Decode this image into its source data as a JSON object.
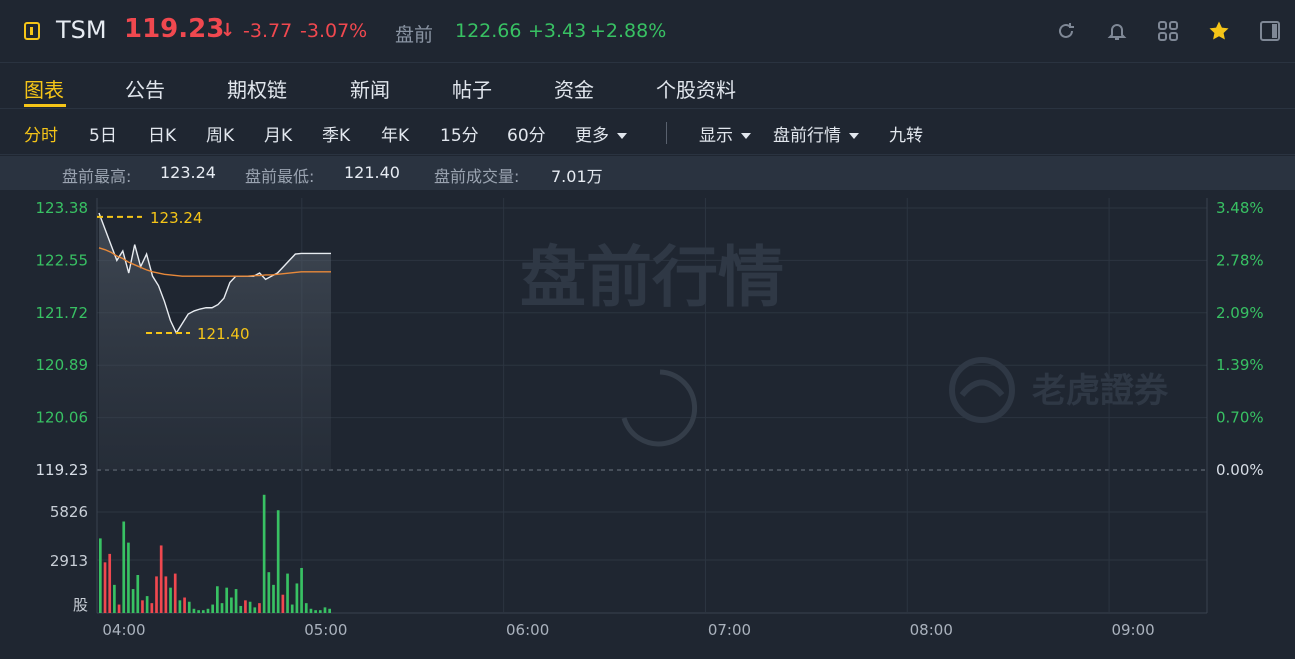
{
  "header": {
    "ticker": "TSM",
    "price": "119.23",
    "arrow": "↓",
    "change": "-3.77",
    "change_pct": "-3.07%",
    "premarket_label": "盘前",
    "premarket_price": "122.66",
    "premarket_change": "+3.43",
    "premarket_pct": "+2.88%",
    "icons": [
      "refresh-icon",
      "bell-icon",
      "grid-icon",
      "star-icon",
      "panel-icon"
    ]
  },
  "tabs": [
    "图表",
    "公告",
    "期权链",
    "新闻",
    "帖子",
    "资金",
    "个股资料"
  ],
  "active_tab": "图表",
  "toolbar": {
    "periods": [
      "分时",
      "5日",
      "日K",
      "周K",
      "月K",
      "季K",
      "年K",
      "15分",
      "60分",
      "更多"
    ],
    "active_period": "分时",
    "display": "显示",
    "market_mode": "盘前行情",
    "nine_turn": "九转"
  },
  "stats": {
    "high_label": "盘前最高:",
    "high_value": "123.24",
    "low_label": "盘前最低:",
    "low_value": "121.40",
    "volume_label": "盘前成交量:",
    "volume_value": "7.01万"
  },
  "colors": {
    "up": "#38c163",
    "down": "#f0484f",
    "accent": "#f5c518",
    "avg_line": "#e8893a",
    "price_line": "#e8ecf1"
  },
  "chart_data": {
    "type": "line",
    "watermark": "盘前行情",
    "brand_watermark": "老虎證券",
    "y_ticks": [
      "123.38",
      "122.55",
      "121.72",
      "120.89",
      "120.06",
      "119.23"
    ],
    "y_pct_ticks": [
      "3.48%",
      "2.78%",
      "2.09%",
      "1.39%",
      "0.70%",
      "0.00%"
    ],
    "x_ticks": [
      "04:00",
      "05:00",
      "06:00",
      "07:00",
      "08:00",
      "09:00"
    ],
    "ylim": [
      119.23,
      123.38
    ],
    "prev_close": 119.23,
    "high_marker": "123.24",
    "low_marker": "121.40",
    "price": [
      123.3,
      123.05,
      122.8,
      122.55,
      122.7,
      122.35,
      122.8,
      122.45,
      122.65,
      122.3,
      122.15,
      121.9,
      121.6,
      121.4,
      121.55,
      121.7,
      121.75,
      121.78,
      121.8,
      121.8,
      121.85,
      121.95,
      122.2,
      122.3,
      122.3,
      122.3,
      122.3,
      122.35,
      122.25,
      122.3,
      122.35,
      122.45,
      122.55,
      122.65,
      122.66,
      122.66,
      122.66,
      122.66,
      122.66,
      122.66
    ],
    "avg": [
      122.75,
      122.72,
      122.68,
      122.62,
      122.58,
      122.52,
      122.48,
      122.44,
      122.4,
      122.37,
      122.35,
      122.33,
      122.32,
      122.31,
      122.3,
      122.3,
      122.3,
      122.3,
      122.3,
      122.3,
      122.3,
      122.3,
      122.3,
      122.3,
      122.3,
      122.3,
      122.31,
      122.31,
      122.32,
      122.32,
      122.33,
      122.34,
      122.35,
      122.36,
      122.37,
      122.37,
      122.37,
      122.37,
      122.37,
      122.37
    ],
    "volume_label": "股",
    "volume_ticks": [
      "5826",
      "2913"
    ],
    "volume_max": 8739,
    "volume": [
      {
        "v": 5300,
        "d": "up"
      },
      {
        "v": 3600,
        "d": "down"
      },
      {
        "v": 4200,
        "d": "down"
      },
      {
        "v": 2000,
        "d": "up"
      },
      {
        "v": 600,
        "d": "down"
      },
      {
        "v": 6500,
        "d": "up"
      },
      {
        "v": 5000,
        "d": "up"
      },
      {
        "v": 1700,
        "d": "up"
      },
      {
        "v": 2700,
        "d": "up"
      },
      {
        "v": 900,
        "d": "down"
      },
      {
        "v": 1200,
        "d": "up"
      },
      {
        "v": 700,
        "d": "down"
      },
      {
        "v": 2600,
        "d": "down"
      },
      {
        "v": 4800,
        "d": "down"
      },
      {
        "v": 2600,
        "d": "down"
      },
      {
        "v": 1800,
        "d": "up"
      },
      {
        "v": 2800,
        "d": "down"
      },
      {
        "v": 900,
        "d": "up"
      },
      {
        "v": 1100,
        "d": "down"
      },
      {
        "v": 800,
        "d": "up"
      },
      {
        "v": 300,
        "d": "up"
      },
      {
        "v": 200,
        "d": "up"
      },
      {
        "v": 200,
        "d": "up"
      },
      {
        "v": 300,
        "d": "up"
      },
      {
        "v": 600,
        "d": "up"
      },
      {
        "v": 1900,
        "d": "up"
      },
      {
        "v": 700,
        "d": "up"
      },
      {
        "v": 1800,
        "d": "up"
      },
      {
        "v": 1100,
        "d": "up"
      },
      {
        "v": 1700,
        "d": "up"
      },
      {
        "v": 500,
        "d": "up"
      },
      {
        "v": 900,
        "d": "down"
      },
      {
        "v": 800,
        "d": "up"
      },
      {
        "v": 400,
        "d": "up"
      },
      {
        "v": 700,
        "d": "down"
      },
      {
        "v": 8400,
        "d": "up"
      },
      {
        "v": 2900,
        "d": "up"
      },
      {
        "v": 2000,
        "d": "up"
      },
      {
        "v": 7300,
        "d": "up"
      },
      {
        "v": 1300,
        "d": "down"
      },
      {
        "v": 2800,
        "d": "up"
      },
      {
        "v": 600,
        "d": "up"
      },
      {
        "v": 2100,
        "d": "up"
      },
      {
        "v": 3200,
        "d": "up"
      },
      {
        "v": 700,
        "d": "up"
      },
      {
        "v": 300,
        "d": "up"
      },
      {
        "v": 200,
        "d": "up"
      },
      {
        "v": 200,
        "d": "up"
      },
      {
        "v": 400,
        "d": "up"
      },
      {
        "v": 300,
        "d": "up"
      }
    ]
  }
}
